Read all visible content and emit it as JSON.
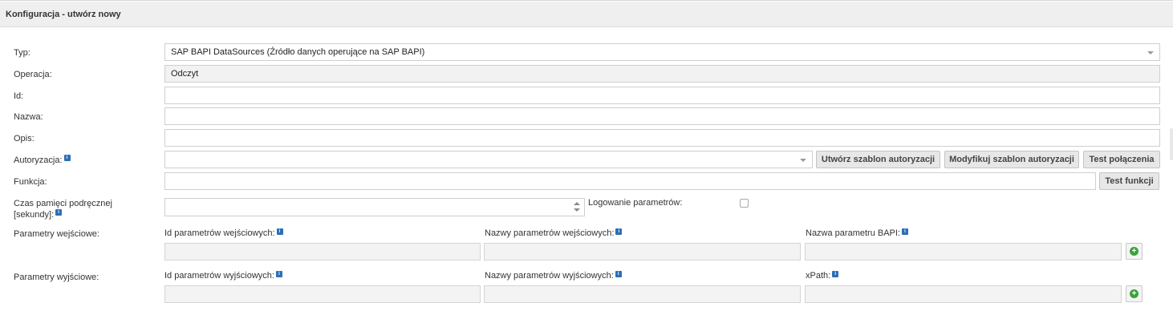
{
  "header": {
    "title": "Konfiguracja - utwórz nowy"
  },
  "form": {
    "typ": {
      "label": "Typ:",
      "value": "SAP BAPI DataSources (Źródło danych operujące na SAP BAPI)"
    },
    "operacja": {
      "label": "Operacja:",
      "value": "Odczyt"
    },
    "id": {
      "label": "Id:",
      "value": ""
    },
    "nazwa": {
      "label": "Nazwa:",
      "value": ""
    },
    "opis": {
      "label": "Opis:",
      "value": ""
    },
    "autoryzacja": {
      "label": "Autoryzacja:",
      "value": "",
      "create_button": "Utwórz szablon autoryzacji",
      "modify_button": "Modyfikuj szablon autoryzacji",
      "test_button": "Test połączenia"
    },
    "funkcja": {
      "label": "Funkcja:",
      "value": "",
      "test_button": "Test funkcji"
    },
    "cache": {
      "label_line1": "Czas pamięci podręcznej",
      "label_line2": "[sekundy]:",
      "value": ""
    },
    "logging": {
      "label": "Logowanie parametrów:",
      "checked": false
    },
    "input_params": {
      "label": "Parametry wejściowe:",
      "col1": "Id parametrów wejściowych:",
      "col2": "Nazwy parametrów wejściowych:",
      "col3": "Nazwa parametru BAPI:"
    },
    "output_params": {
      "label": "Parametry wyjściowe:",
      "col1": "Id parametrów wyjściowych:",
      "col2": "Nazwy parametrów wyjściowych:",
      "col3": "xPath:"
    }
  },
  "icons": {
    "info": "info-icon",
    "add": "add-icon",
    "dropdown": "chevron-down-icon"
  },
  "colors": {
    "info_icon": "#2c6fb7",
    "add_icon": "#3aa33a",
    "header_bg": "#efefef"
  }
}
